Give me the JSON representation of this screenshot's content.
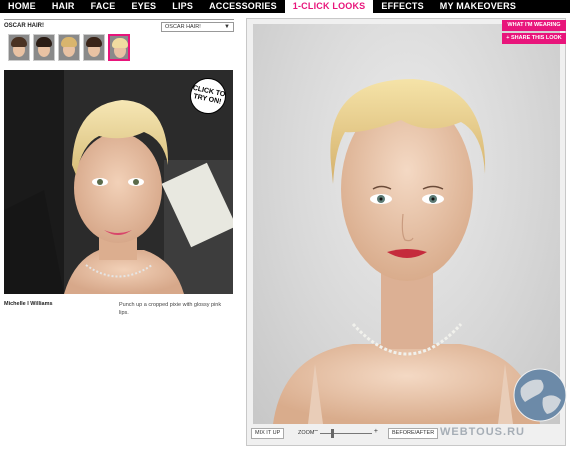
{
  "nav": {
    "items": [
      "HOME",
      "HAIR",
      "FACE",
      "EYES",
      "LIPS",
      "ACCESSORIES",
      "1-CLICK LOOKS",
      "EFFECTS",
      "MY MAKEOVERS"
    ],
    "active_index": 6,
    "active_color": "#e8157b"
  },
  "left": {
    "section_label": "OSCAR HAIR!",
    "dropdown_value": "OSCAR HAIR!",
    "thumbs": [
      {
        "hair": "#4a3222",
        "selected": false
      },
      {
        "hair": "#2b1d15",
        "selected": false
      },
      {
        "hair": "#d9b56d",
        "selected": false
      },
      {
        "hair": "#3a2418",
        "selected": false
      },
      {
        "hair": "#f0dca0",
        "selected": true
      }
    ],
    "badge": "CLICK TO TRY ON!",
    "caption_name": "Michelle I Williams",
    "caption_desc": "Punch up a cropped pixie with glossy pink lips."
  },
  "right": {
    "what_wearing": "WHAT I'M WEARING",
    "share": "+ SHARE THIS LOOK",
    "mix_it_up": "MIX IT UP",
    "zoom": "ZOOM",
    "zoom_level": 0.22,
    "before_after": "BEFORE/AFTER",
    "watermark": "WEBTOUS.RU"
  }
}
